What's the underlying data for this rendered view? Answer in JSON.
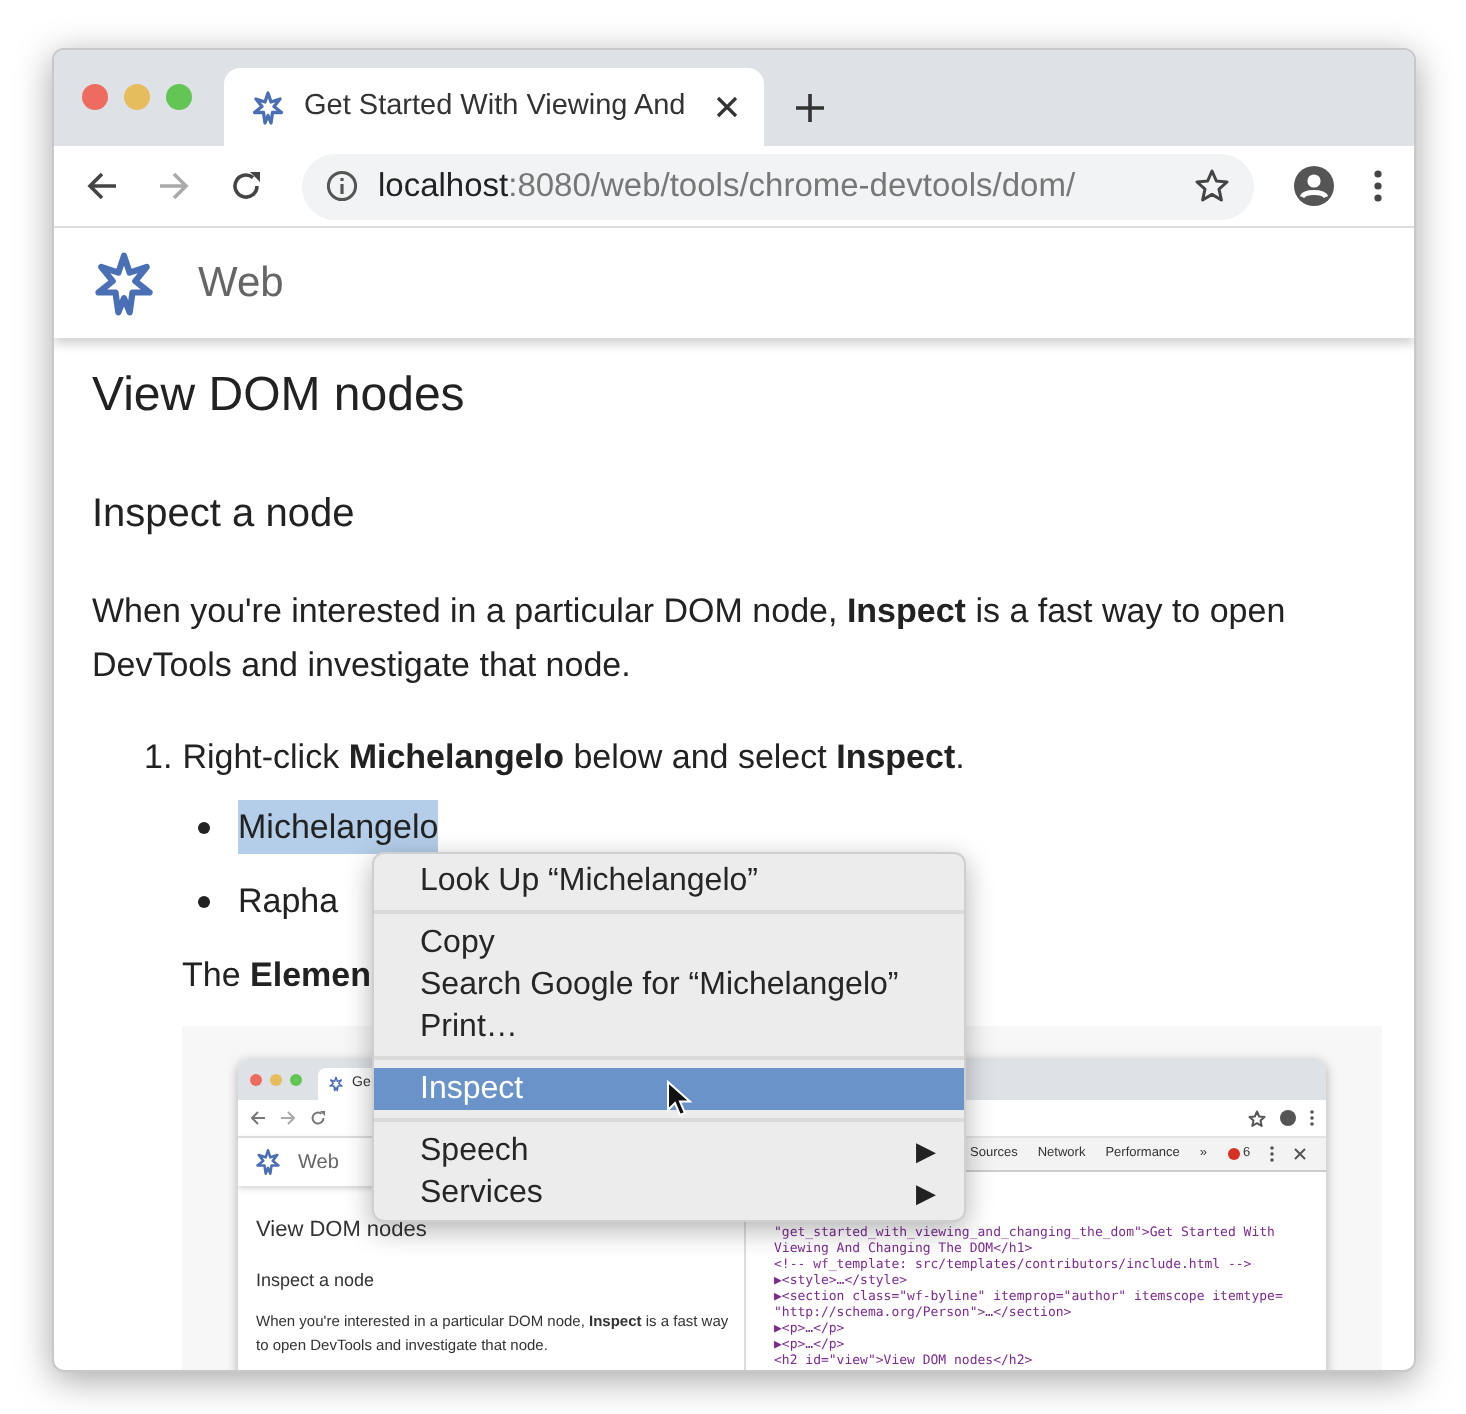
{
  "window": {
    "traffic_lights": [
      {
        "color": "#ed6b5f"
      },
      {
        "color": "#e6bd5c"
      },
      {
        "color": "#62c554"
      }
    ]
  },
  "tab": {
    "title": "Get Started With Viewing And",
    "selected": true
  },
  "address_bar": {
    "host": "localhost",
    "path": ":8080/web/tools/chrome-devtools/dom/"
  },
  "site_header": {
    "title": "Web"
  },
  "article": {
    "heading": "View DOM nodes",
    "subheading": "Inspect a node",
    "paragraph": "When you're interested in a particular DOM node, **Inspect** is a fast way to open DevTools and investigate that node.",
    "steps": [
      {
        "number": "1.",
        "text": "Right-click **Michelangelo** below and select **Inspect**.",
        "bullets": [
          {
            "text": "Michelangelo",
            "selected": true
          },
          {
            "text": "Rapha",
            "selected": false
          }
        ]
      }
    ],
    "after": "The **Elemen**"
  },
  "embedded_screenshot": {
    "tab_title": "Ge",
    "site_title": "Web",
    "heading": "View DOM nodes",
    "subheading": "Inspect a node",
    "paragraph": "When you're interested in a particular DOM node, **Inspect** is a fast way to open DevTools and investigate that node.",
    "devtools_tabs": [
      "Sources",
      "Network",
      "Performance"
    ],
    "overflow": "»",
    "error_count": "6",
    "code_lines": [
      "\"get_started_with_viewing_and_changing_the_dom\">Get Started With",
      "Viewing And Changing The DOM</h1>",
      "<!-- wf_template: src/templates/contributors/include.html -->",
      "▶<style>…</style>",
      "▶<section class=\"wf-byline\" itemprop=\"author\" itemscope itemtype=",
      "\"http://schema.org/Person\">…</section>",
      "▶<p>…</p>",
      "▶<p>…</p>",
      "<h2 id=\"view\">View DOM nodes</h2>"
    ]
  },
  "context_menu": {
    "items": [
      {
        "kind": "item",
        "label": "Look Up “Michelangelo”",
        "selected": false
      },
      {
        "kind": "separator"
      },
      {
        "kind": "item",
        "label": "Copy",
        "selected": false
      },
      {
        "kind": "item",
        "label": "Search Google for “Michelangelo”",
        "selected": false
      },
      {
        "kind": "item",
        "label": "Print…",
        "selected": false
      },
      {
        "kind": "separator"
      },
      {
        "kind": "item",
        "label": "Inspect",
        "selected": true
      },
      {
        "kind": "separator"
      },
      {
        "kind": "submenu",
        "label": "Speech",
        "selected": false,
        "arrow": "▶"
      },
      {
        "kind": "submenu",
        "label": "Services",
        "selected": false,
        "arrow": "▶"
      }
    ]
  }
}
